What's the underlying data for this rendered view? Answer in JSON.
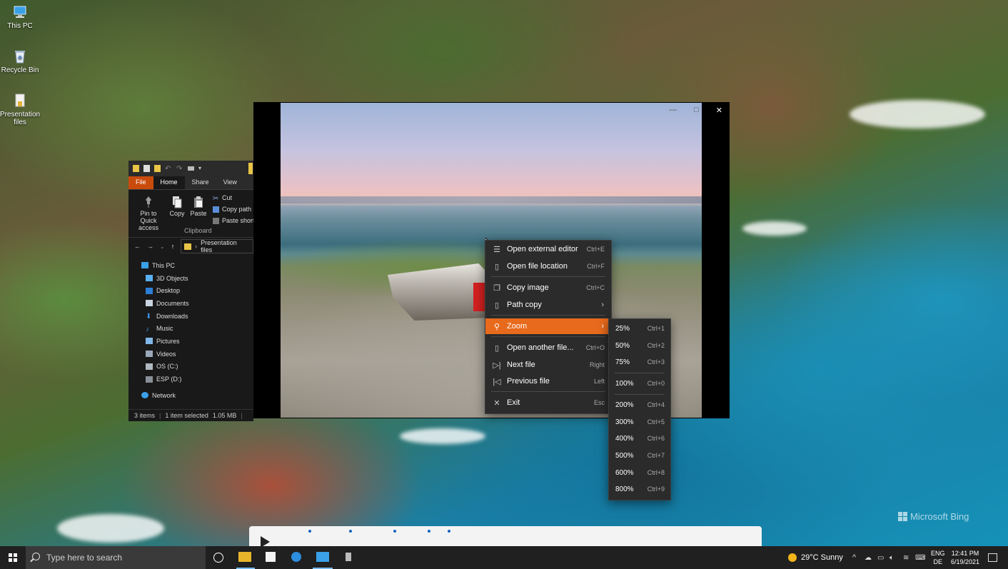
{
  "desktop": {
    "icons": [
      {
        "label": "This PC",
        "icon": "computer-icon"
      },
      {
        "label": "Recycle Bin",
        "icon": "recycle-bin-icon"
      },
      {
        "label": "Presentation files",
        "icon": "folder-icon"
      }
    ],
    "watermark": "Microsoft Bing"
  },
  "explorer": {
    "tabs": [
      "File",
      "Home",
      "Share",
      "View"
    ],
    "ribbon": {
      "pin_label": "Pin to Quick access",
      "copy_label": "Copy",
      "paste_label": "Paste",
      "cut_label": "Cut",
      "copy_path_label": "Copy path",
      "paste_shortcut_label": "Paste shortc",
      "group_label": "Clipboard"
    },
    "address": "Presentation files",
    "tree": [
      {
        "label": "This PC",
        "icon": "computer-icon",
        "indent": 0
      },
      {
        "label": "3D Objects",
        "icon": "cube-icon",
        "indent": 1
      },
      {
        "label": "Desktop",
        "icon": "desktop-icon",
        "indent": 1
      },
      {
        "label": "Documents",
        "icon": "document-icon",
        "indent": 1
      },
      {
        "label": "Downloads",
        "icon": "download-icon",
        "indent": 1
      },
      {
        "label": "Music",
        "icon": "music-icon",
        "indent": 1
      },
      {
        "label": "Pictures",
        "icon": "picture-icon",
        "indent": 1
      },
      {
        "label": "Videos",
        "icon": "video-icon",
        "indent": 1
      },
      {
        "label": "OS (C:)",
        "icon": "drive-icon",
        "indent": 1
      },
      {
        "label": "ESP (D:)",
        "icon": "drive-icon",
        "indent": 1
      },
      {
        "label": "Network",
        "icon": "network-icon",
        "indent": 0
      }
    ],
    "status": {
      "items": "3 items",
      "selected": "1 item selected",
      "size": "1.05 MB"
    }
  },
  "context_menu": {
    "items": [
      {
        "icon": "external-editor-icon",
        "label": "Open external editor",
        "shortcut": "Ctrl+E"
      },
      {
        "icon": "file-location-icon",
        "label": "Open file location",
        "shortcut": "Ctrl+F"
      },
      {
        "icon": "copy-icon",
        "label": "Copy image",
        "shortcut": "Ctrl+C"
      },
      {
        "icon": "path-icon",
        "label": "Path copy",
        "shortcut": "",
        "submenu": true
      },
      {
        "icon": "zoom-icon",
        "label": "Zoom",
        "shortcut": "",
        "submenu": true,
        "highlighted": true
      },
      {
        "icon": "open-file-icon",
        "label": "Open another file...",
        "shortcut": "Ctrl+O"
      },
      {
        "icon": "next-icon",
        "label": "Next file",
        "shortcut": "Right"
      },
      {
        "icon": "previous-icon",
        "label": "Previous file",
        "shortcut": "Left"
      },
      {
        "icon": "close-icon",
        "label": "Exit",
        "shortcut": "Esc"
      }
    ]
  },
  "zoom_menu": {
    "items": [
      {
        "label": "25%",
        "shortcut": "Ctrl+1"
      },
      {
        "label": "50%",
        "shortcut": "Ctrl+2"
      },
      {
        "label": "75%",
        "shortcut": "Ctrl+3"
      },
      {
        "label": "100%",
        "shortcut": "Ctrl+0"
      },
      {
        "label": "200%",
        "shortcut": "Ctrl+4"
      },
      {
        "label": "300%",
        "shortcut": "Ctrl+5"
      },
      {
        "label": "400%",
        "shortcut": "Ctrl+6"
      },
      {
        "label": "500%",
        "shortcut": "Ctrl+7"
      },
      {
        "label": "600%",
        "shortcut": "Ctrl+8"
      },
      {
        "label": "800%",
        "shortcut": "Ctrl+9"
      }
    ]
  },
  "viewer": {
    "close_glyph": "✕",
    "maximize_glyph": "□",
    "minimize_glyph": "—"
  },
  "taskbar": {
    "search_placeholder": "Type here to search",
    "weather": "29°C  Sunny",
    "language": "ENG",
    "region": "DE",
    "time": "12:41 PM",
    "date": "6/19/2021"
  },
  "colors": {
    "accent_highlight": "#e86a1d",
    "menu_bg": "#2b2b2b",
    "taskbar_bg": "#202020",
    "file_tab": "#c94b0c"
  }
}
